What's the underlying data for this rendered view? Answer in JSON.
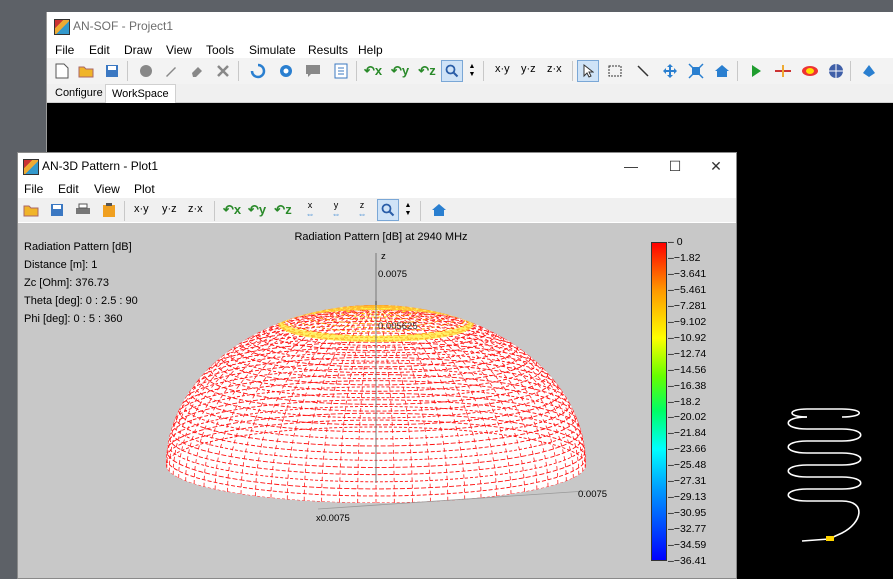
{
  "main_window": {
    "title": "AN-SOF - Project1",
    "menu": [
      "File",
      "Edit",
      "Draw",
      "View",
      "Tools",
      "Simulate",
      "Results",
      "Help"
    ],
    "toolbar_text": {
      "xy": "x·y",
      "yz": "y·z",
      "zx": "z·x"
    },
    "tabs": [
      "Configure",
      "WorkSpace"
    ],
    "active_tab": "WorkSpace"
  },
  "plot_window": {
    "title": "AN-3D Pattern - Plot1",
    "controls": {
      "minimize": "—",
      "maximize": "☐",
      "close": "✕"
    },
    "menu": [
      "File",
      "Edit",
      "View",
      "Plot"
    ],
    "toolbar_text": {
      "xy": "x·y",
      "yz": "y·z",
      "zx": "z·x",
      "x_axis": "x",
      "y_axis": "y",
      "z_axis": "z"
    },
    "header": "Radiation Pattern [dB] at 2940 MHz",
    "info": [
      "Radiation Pattern [dB]",
      "Distance [m]: 1",
      "Zc [Ohm]: 376.73",
      "Theta [deg]: 0 : 2.5 : 90",
      "Phi [deg]: 0 : 5 : 360"
    ],
    "axes": {
      "z_label": "z",
      "z_tick": "0.0075",
      "z_tick_mid": "0.005625",
      "y_tick": "0.0075",
      "x_tick": "x0.0075"
    },
    "colorbar": {
      "ticks": [
        "0",
        "−1.82",
        "−3.641",
        "−5.461",
        "−7.281",
        "−9.102",
        "−10.92",
        "−12.74",
        "−14.56",
        "−16.38",
        "−18.2",
        "−20.02",
        "−21.84",
        "−23.66",
        "−25.48",
        "−27.31",
        "−29.13",
        "−30.95",
        "−32.77",
        "−34.59",
        "−36.41"
      ],
      "top_color": "#ff0000",
      "bottom_color": "#0000ff"
    }
  }
}
